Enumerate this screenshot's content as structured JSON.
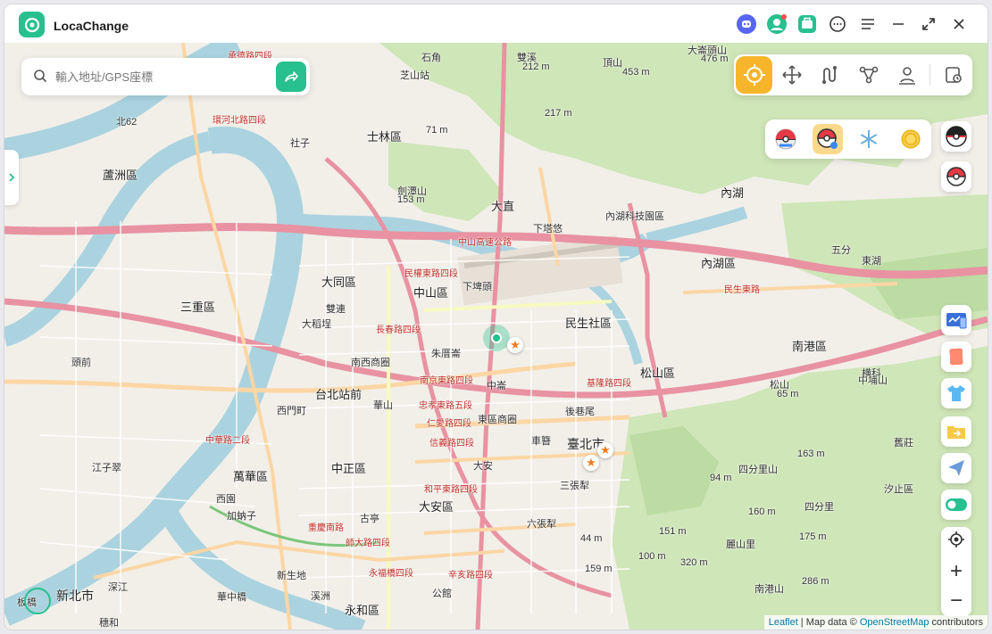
{
  "app": {
    "title": "LocaChange"
  },
  "titlebar": {
    "icons": [
      "discord-icon",
      "user-status-icon",
      "toolbox-icon",
      "feedback-icon",
      "menu-icon",
      "minimize-icon",
      "maximize-icon",
      "close-icon"
    ]
  },
  "search": {
    "placeholder": "輸入地址/GPS座標"
  },
  "modes": [
    "teleport-mode",
    "two-spot-mode",
    "multi-spot-mode",
    "joystick-mode",
    "jump-teleport-mode",
    "history"
  ],
  "pokemon_tools": [
    "pokestop-icon",
    "pokeball-icon",
    "snowflake-icon",
    "coin-icon"
  ],
  "side_tools": [
    "pokeball-dark-icon",
    "pokeball-icon",
    "device-icon",
    "cards-icon",
    "shirt-icon",
    "folder-icon",
    "send-icon",
    "toggle-icon"
  ],
  "zoom": {
    "in": "+",
    "out": "−"
  },
  "attribution": {
    "leaflet": "Leaflet",
    "sep": " | Map data © ",
    "osm": "OpenStreetMap",
    "contrib": " contributors"
  },
  "colors": {
    "accent": "#27c08e",
    "active_mode": "#f7b52c"
  },
  "map": {
    "labels": [
      {
        "t": "承德路四段",
        "k": "red"
      },
      {
        "t": "石角",
        "k": ""
      },
      {
        "t": "芝山站",
        "k": ""
      },
      {
        "t": "雙溪",
        "k": ""
      },
      {
        "t": "212 m",
        "k": ""
      },
      {
        "t": "頂山",
        "k": ""
      },
      {
        "t": "453 m",
        "k": ""
      },
      {
        "t": "大崙頭山",
        "k": ""
      },
      {
        "t": "476 m",
        "k": ""
      },
      {
        "t": "環河北路四段",
        "k": "red"
      },
      {
        "t": "北62",
        "k": ""
      },
      {
        "t": "社子",
        "k": ""
      },
      {
        "t": "士林區",
        "k": "dist"
      },
      {
        "t": "71 m",
        "k": ""
      },
      {
        "t": "217 m",
        "k": ""
      },
      {
        "t": "劍潭山",
        "k": ""
      },
      {
        "t": "153 m",
        "k": ""
      },
      {
        "t": "大直",
        "k": "dist"
      },
      {
        "t": "下塔悠",
        "k": ""
      },
      {
        "t": "內湖科技園區",
        "k": ""
      },
      {
        "t": "內湖",
        "k": "dist"
      },
      {
        "t": "五分",
        "k": ""
      },
      {
        "t": "東湖",
        "k": ""
      },
      {
        "t": "蘆洲區",
        "k": "dist"
      },
      {
        "t": "三重區",
        "k": "dist"
      },
      {
        "t": "大同區",
        "k": "dist"
      },
      {
        "t": "中山區",
        "k": "dist"
      },
      {
        "t": "下埤頭",
        "k": ""
      },
      {
        "t": "民生社區",
        "k": "dist"
      },
      {
        "t": "內湖區",
        "k": "dist"
      },
      {
        "t": "大稻埕",
        "k": ""
      },
      {
        "t": "雙連",
        "k": ""
      },
      {
        "t": "朱厝崙",
        "k": ""
      },
      {
        "t": "南西商圈",
        "k": ""
      },
      {
        "t": "台北站前",
        "k": "dist"
      },
      {
        "t": "中崙",
        "k": ""
      },
      {
        "t": "松山區",
        "k": "dist"
      },
      {
        "t": "南港區",
        "k": "dist"
      },
      {
        "t": "頭前",
        "k": ""
      },
      {
        "t": "西門町",
        "k": ""
      },
      {
        "t": "華山",
        "k": ""
      },
      {
        "t": "東區商圈",
        "k": ""
      },
      {
        "t": "後巷尾",
        "k": ""
      },
      {
        "t": "車簪",
        "k": ""
      },
      {
        "t": "臺北市",
        "k": "city"
      },
      {
        "t": "三張犁",
        "k": ""
      },
      {
        "t": "中正區",
        "k": "dist"
      },
      {
        "t": "大安",
        "k": ""
      },
      {
        "t": "萬華區",
        "k": "dist"
      },
      {
        "t": "江子翠",
        "k": ""
      },
      {
        "t": "西園",
        "k": ""
      },
      {
        "t": "加蚋子",
        "k": ""
      },
      {
        "t": "大安區",
        "k": "dist"
      },
      {
        "t": "古亭",
        "k": ""
      },
      {
        "t": "六張犁",
        "k": ""
      },
      {
        "t": "麗山里",
        "k": ""
      },
      {
        "t": "新生地",
        "k": ""
      },
      {
        "t": "溪洲",
        "k": ""
      },
      {
        "t": "公館",
        "k": ""
      },
      {
        "t": "永和區",
        "k": "dist"
      },
      {
        "t": "新北市",
        "k": "city"
      },
      {
        "t": "深江",
        "k": ""
      },
      {
        "t": "華中橋",
        "k": ""
      },
      {
        "t": "板橋",
        "k": ""
      },
      {
        "t": "穗和",
        "k": ""
      },
      {
        "t": "中山高速公路",
        "k": "red"
      },
      {
        "t": "民權東路四段",
        "k": "red"
      },
      {
        "t": "民生東路",
        "k": "red"
      },
      {
        "t": "長春路四段",
        "k": "red"
      },
      {
        "t": "南京東路四段",
        "k": "red"
      },
      {
        "t": "忠孝東路五段",
        "k": "red"
      },
      {
        "t": "仁愛路四段",
        "k": "red"
      },
      {
        "t": "信義路四段",
        "k": "red"
      },
      {
        "t": "和平東路四段",
        "k": "red"
      },
      {
        "t": "基隆路四段",
        "k": "red"
      },
      {
        "t": "中華路二段",
        "k": "red"
      },
      {
        "t": "重慶南路",
        "k": "red"
      },
      {
        "t": "師大路四段",
        "k": "red"
      },
      {
        "t": "永福橋四段",
        "k": "red"
      },
      {
        "t": "辛亥路四段",
        "k": "red"
      },
      {
        "t": "松山",
        "k": ""
      },
      {
        "t": "中埔山",
        "k": ""
      },
      {
        "t": "65 m",
        "k": ""
      },
      {
        "t": "163 m",
        "k": ""
      },
      {
        "t": "94 m",
        "k": ""
      },
      {
        "t": "四分里山",
        "k": ""
      },
      {
        "t": "四分里",
        "k": ""
      },
      {
        "t": "160 m",
        "k": ""
      },
      {
        "t": "44 m",
        "k": ""
      },
      {
        "t": "151 m",
        "k": ""
      },
      {
        "t": "175 m",
        "k": ""
      },
      {
        "t": "159 m",
        "k": ""
      },
      {
        "t": "100 m",
        "k": ""
      },
      {
        "t": "320 m",
        "k": ""
      },
      {
        "t": "286 m",
        "k": ""
      },
      {
        "t": "南港山",
        "k": ""
      },
      {
        "t": "横科",
        "k": ""
      },
      {
        "t": "舊莊",
        "k": ""
      },
      {
        "t": "汐止區",
        "k": ""
      }
    ]
  }
}
